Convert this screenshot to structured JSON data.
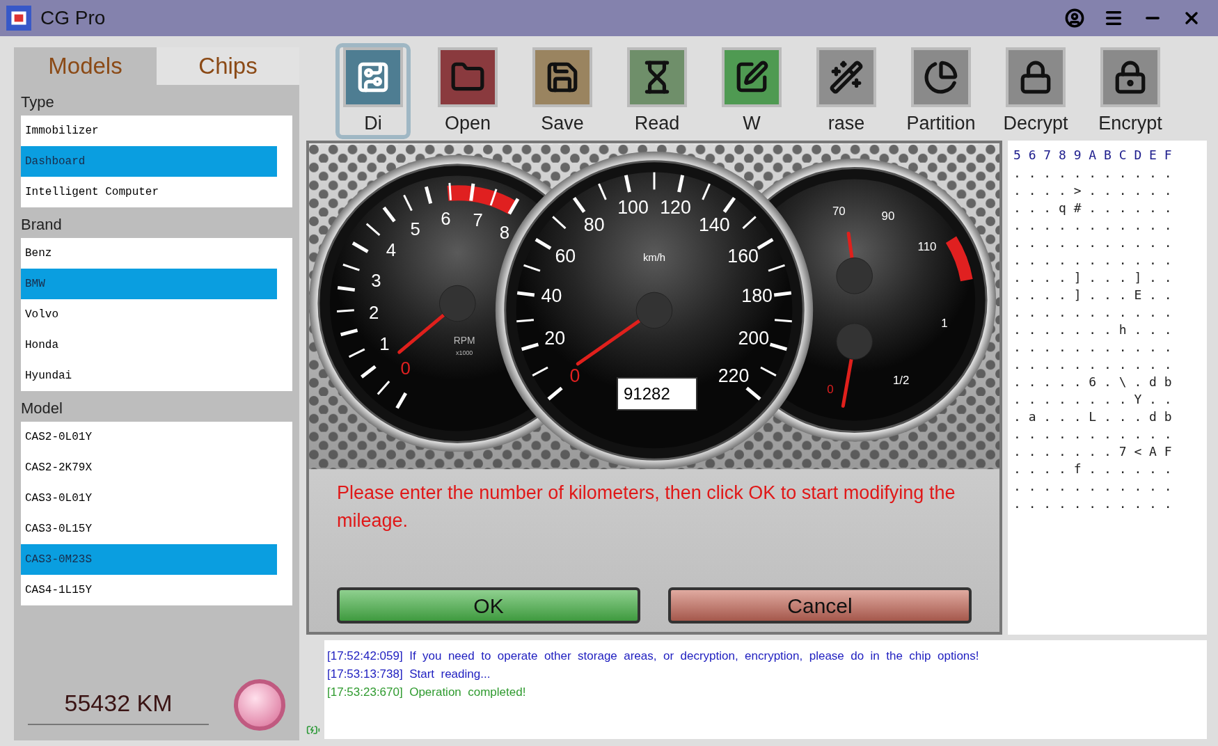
{
  "window": {
    "title": "CG Pro"
  },
  "sidebar": {
    "tabs": [
      {
        "label": "Models",
        "selected": true
      },
      {
        "label": "Chips",
        "selected": false
      }
    ],
    "groups": [
      {
        "title": "Type",
        "items": [
          {
            "label": "Immobilizer",
            "selected": false
          },
          {
            "label": "Dashboard",
            "selected": true
          },
          {
            "label": "Intelligent Computer",
            "selected": false
          }
        ]
      },
      {
        "title": "Brand",
        "items": [
          {
            "label": "Benz",
            "selected": false
          },
          {
            "label": "BMW",
            "selected": true
          },
          {
            "label": "Volvo",
            "selected": false
          },
          {
            "label": "Honda",
            "selected": false
          },
          {
            "label": "Hyundai",
            "selected": false
          }
        ]
      },
      {
        "title": "Model",
        "items": [
          {
            "label": "CAS2-0L01Y",
            "selected": false
          },
          {
            "label": "CAS2-2K79X",
            "selected": false
          },
          {
            "label": "CAS3-0L01Y",
            "selected": false
          },
          {
            "label": "CAS3-0L15Y",
            "selected": false
          },
          {
            "label": "CAS3-0M23S",
            "selected": true
          },
          {
            "label": "CAS4-1L15Y",
            "selected": false
          }
        ]
      }
    ],
    "mileage": "55432 KM"
  },
  "toolbar": [
    {
      "kind": "circuit",
      "label": "Di",
      "selected": true,
      "color": "#4e7d92"
    },
    {
      "kind": "open",
      "label": "Open",
      "selected": false,
      "color": "#8a3a3e"
    },
    {
      "kind": "save",
      "label": "Save",
      "selected": false,
      "color": "#9a8460"
    },
    {
      "kind": "read",
      "label": "Read",
      "selected": false,
      "color": "#6f8f6a"
    },
    {
      "kind": "write",
      "label": "W",
      "selected": false,
      "color": "#4f9a52"
    },
    {
      "kind": "erase",
      "label": "rase",
      "selected": false,
      "color": "#8e8e8e"
    },
    {
      "kind": "partition",
      "label": "Partition",
      "selected": false,
      "color": "#8a8a8a"
    },
    {
      "kind": "decrypt",
      "label": "Decrypt",
      "selected": false,
      "color": "#8a8a8a"
    },
    {
      "kind": "encrypt",
      "label": "Encrypt",
      "selected": false,
      "color": "#8a8a8a"
    }
  ],
  "dialog": {
    "tachometer": {
      "labels": [
        "6",
        "7",
        "8",
        "5",
        "4",
        "3",
        "2",
        "1",
        "0"
      ],
      "unit": "RPM",
      "subunit": "x1000"
    },
    "speedometer": {
      "labels": [
        "0",
        "20",
        "40",
        "60",
        "80",
        "100",
        "120",
        "140",
        "160",
        "180",
        "200",
        "220"
      ],
      "unit": "km/h",
      "odometer": "91282"
    },
    "temperature": {
      "labels": [
        "70",
        "90",
        "110"
      ]
    },
    "fuel": {
      "labels": [
        "0",
        "1/2",
        "1"
      ]
    },
    "message": "Please enter the number of kilometers, then click OK to start modifying the mileage.",
    "buttons": [
      {
        "kind": "ok",
        "label": "OK"
      },
      {
        "kind": "cancel",
        "label": "Cancel"
      }
    ]
  },
  "hex": {
    "header": "5 6 7 8 9 A B C D E F",
    "rows": [
      ". . . . . . . . . . .",
      ". . . . > . . . . . .",
      ". . . q # . . . . . .",
      ". . . . . . . . . . .",
      ". . . . . . . . . . .",
      ". . . . . . . . . . .",
      ". . . . ] . . . ] . .",
      ". . . . ] . . . E . .",
      ". . . . . . . . . . .",
      ". . . . . . . h . . .",
      ". . . . . . . . . . .",
      ". . . . . . . . . . .",
      ". . . . . 6 . \\ . d b",
      ". . . . . . . . Y . .",
      ". a . . . L . . . d b",
      ". . . . . . . . . . .",
      ". . . . . . . 7 < A F",
      ". . . . f . . . . . .",
      ". . . . . . . . . . .",
      ". . . . . . . . . . ."
    ]
  },
  "log": [
    {
      "kind": "info",
      "text": "[17:52:42:059]  If  you  need  to  operate  other  storage  areas,  or  decryption,  encryption,  please  do  in  the  chip  options!"
    },
    {
      "kind": "info",
      "text": "[17:53:13:738]  Start  reading..."
    },
    {
      "kind": "success",
      "text": "[17:53:23:670]  Operation  completed!"
    }
  ]
}
